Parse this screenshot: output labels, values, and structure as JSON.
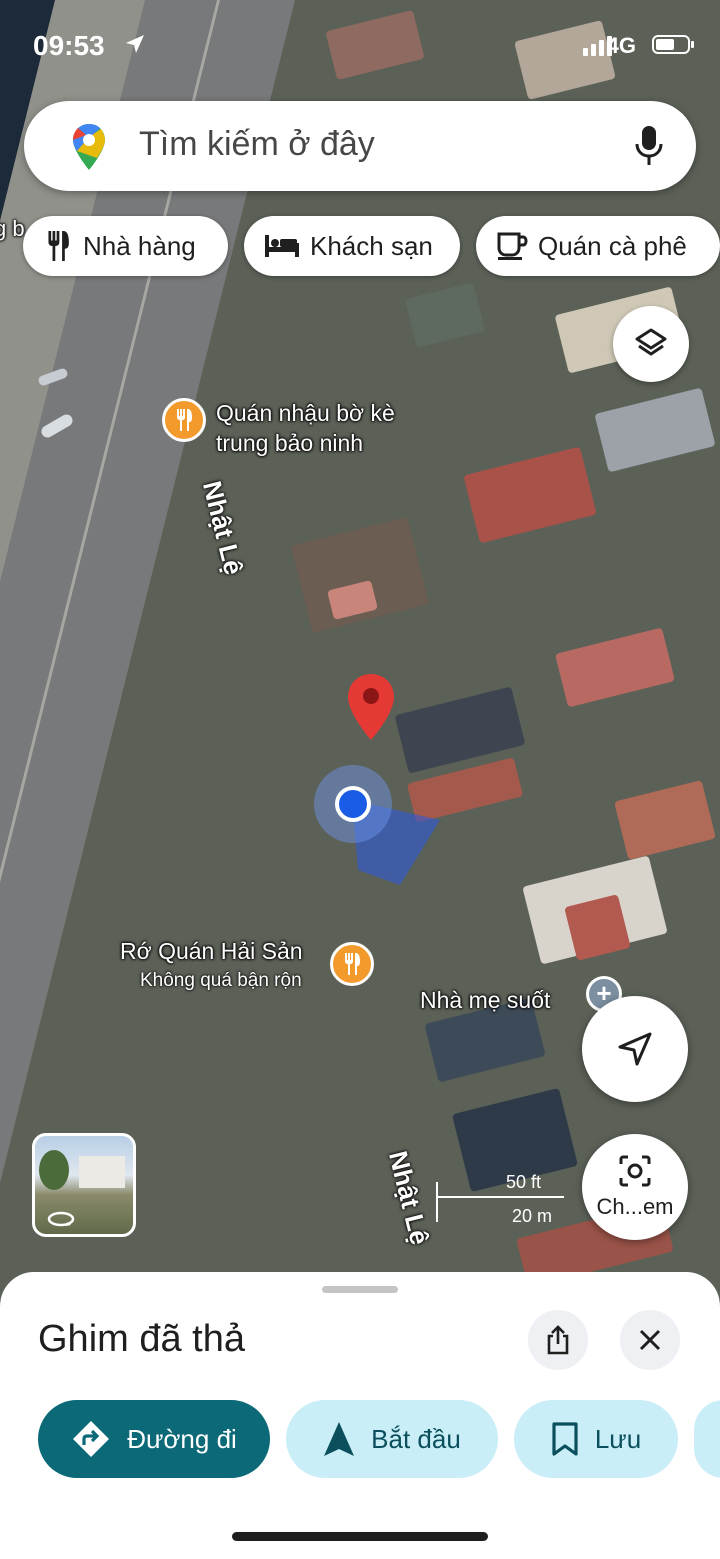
{
  "status_bar": {
    "time": "09:53",
    "network": "4G"
  },
  "search": {
    "placeholder": "Tìm kiếm ở đây"
  },
  "chips": [
    {
      "label": "Nhà hàng",
      "icon": "restaurant-icon"
    },
    {
      "label": "Khách sạn",
      "icon": "hotel-icon"
    },
    {
      "label": "Quán cà phê",
      "icon": "coffee-icon"
    }
  ],
  "map": {
    "pois": [
      {
        "line1": "Quán nhậu bờ kè",
        "line2": "trung bảo ninh"
      },
      {
        "line1": "Rớ Quán Hải Sản",
        "line2": "Không quá bận rộn"
      },
      {
        "line1": "Nhà mẹ suốt"
      }
    ],
    "streets": [
      "Nhật Lệ",
      "Nhật Lệ"
    ],
    "scale": {
      "feet": "50 ft",
      "meters": "20 m"
    },
    "lens_label": "Ch...em",
    "edge_label": "g b"
  },
  "sheet": {
    "title": "Ghim đã thả",
    "actions": [
      {
        "label": "Đường đi"
      },
      {
        "label": "Bắt đầu"
      },
      {
        "label": "Lưu"
      }
    ]
  },
  "colors": {
    "primary": "#0b6978",
    "secondary": "#c9eef8",
    "poi_orange": "#f39a2c",
    "pin_red": "#e53935",
    "location_blue": "#1a5ce6"
  }
}
